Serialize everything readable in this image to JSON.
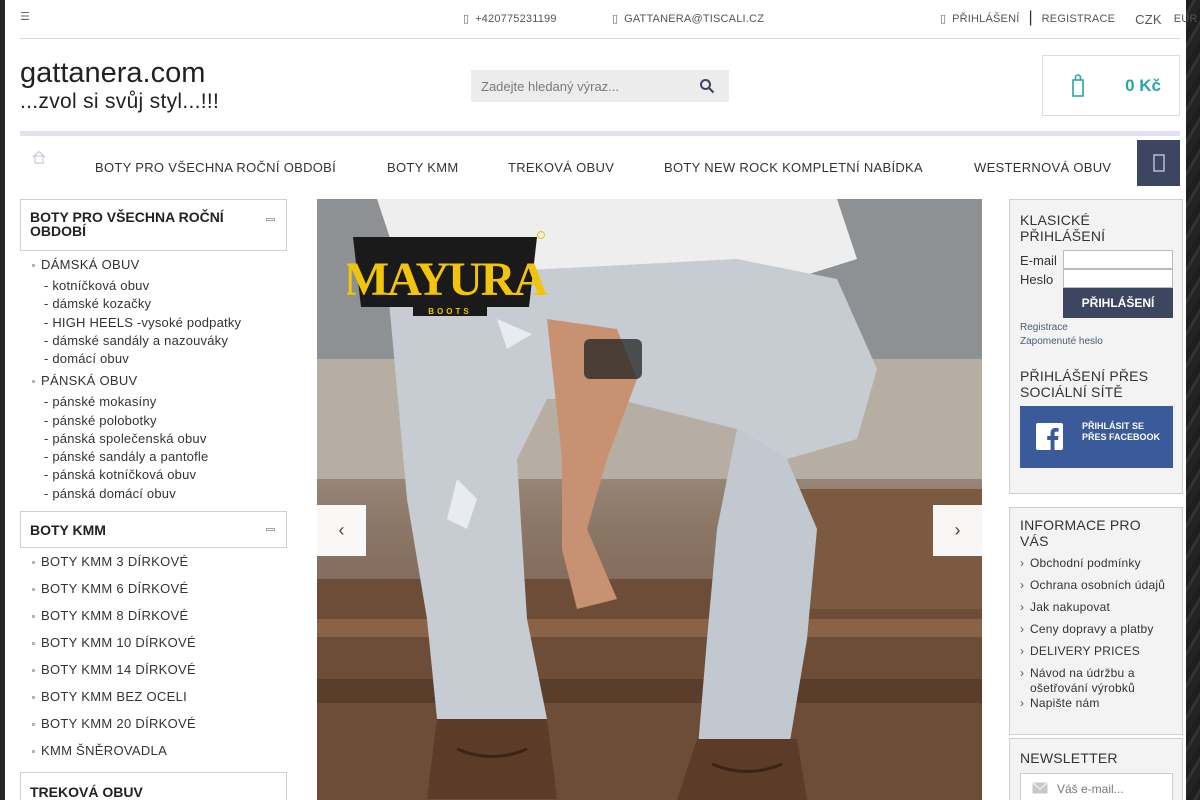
{
  "topbar": {
    "phone": "+420775231199",
    "email": "GATTANERA@TISCALI.CZ",
    "login": "PŘIHLÁŠENÍ",
    "separator": "|",
    "register": "REGISTRACE",
    "currency_active": "CZK",
    "currency_other": "EUR"
  },
  "header": {
    "site_title": "gattanera.com",
    "tagline": "...zvol si svůj styl...!!!",
    "search_placeholder": "Zadejte hledaný výraz...",
    "cart_total": "0 Kč"
  },
  "nav": {
    "items": [
      "BOTY PRO VŠECHNA ROČNÍ OBDOBÍ",
      "BOTY KMM",
      "TREKOVÁ OBUV",
      "BOTY NEW ROCK KOMPLETNÍ NABÍDKA",
      "WESTERNOVÁ OBUV"
    ]
  },
  "left_sidebar": {
    "section1": {
      "title": "BOTY PRO VŠECHNA ROČNÍ OBDOBÍ",
      "group1": "DÁMSKÁ OBUV",
      "group1_items": [
        "- kotníčková obuv",
        "- dámské kozačky",
        "- HIGH HEELS -vysoké podpatky",
        "- dámské sandály a nazouváky",
        "- domácí obuv"
      ],
      "group2": "PÁNSKÁ OBUV",
      "group2_items": [
        "- pánské mokasíny",
        "- pánské polobotky",
        "- pánská společenská obuv",
        "- pánské sandály a pantofle",
        "- pánská kotníčková obuv",
        "- pánská domácí obuv"
      ]
    },
    "section2": {
      "title": "BOTY KMM",
      "items": [
        "BOTY KMM 3 DÍRKOVÉ",
        "BOTY KMM 6 DÍRKOVÉ",
        "BOTY KMM 8 DÍRKOVÉ",
        "BOTY KMM 10 DÍRKOVÉ",
        "BOTY KMM 14 DÍRKOVÉ",
        "BOTY KMM BEZ OCELI",
        "BOTY KMM 20 DÍRKOVÉ",
        "KMM ŠNĚROVADLA"
      ]
    },
    "section3": {
      "title": "TREKOVÁ OBUV"
    }
  },
  "banner": {
    "brand_logo": "MAYURA",
    "brand_sub": "BOOTS",
    "prev_icon": "chevron-left-icon",
    "next_icon": "chevron-right-icon"
  },
  "right_sidebar": {
    "login_box": {
      "title": "KLASICKÉ PŘIHLÁŠENÍ",
      "email_label": "E-mail",
      "password_label": "Heslo",
      "submit": "PŘIHLÁŠENÍ",
      "register_link": "Registrace",
      "forgot_link": "Zapomenuté heslo",
      "social_title": "PŘIHLÁŠENÍ PŘES SOCIÁLNÍ SÍTĚ",
      "facebook_button": "PŘIHLÁSIT SE PŘES FACEBOOK"
    },
    "info_box": {
      "title": "INFORMACE PRO VÁS",
      "links": [
        "Obchodní podmínky",
        "Ochrana osobních údajů",
        "Jak nakupovat",
        "Ceny dopravy a platby",
        "DELIVERY PRICES",
        "Návod na údržbu a ošetřování výrobků",
        "Napište nám"
      ]
    },
    "newsletter": {
      "title": "NEWSLETTER",
      "placeholder": "Váš e-mail..."
    }
  },
  "colors": {
    "accent": "#2aa7a1",
    "dark_blue": "#3c4660",
    "facebook": "#3a5a99"
  }
}
